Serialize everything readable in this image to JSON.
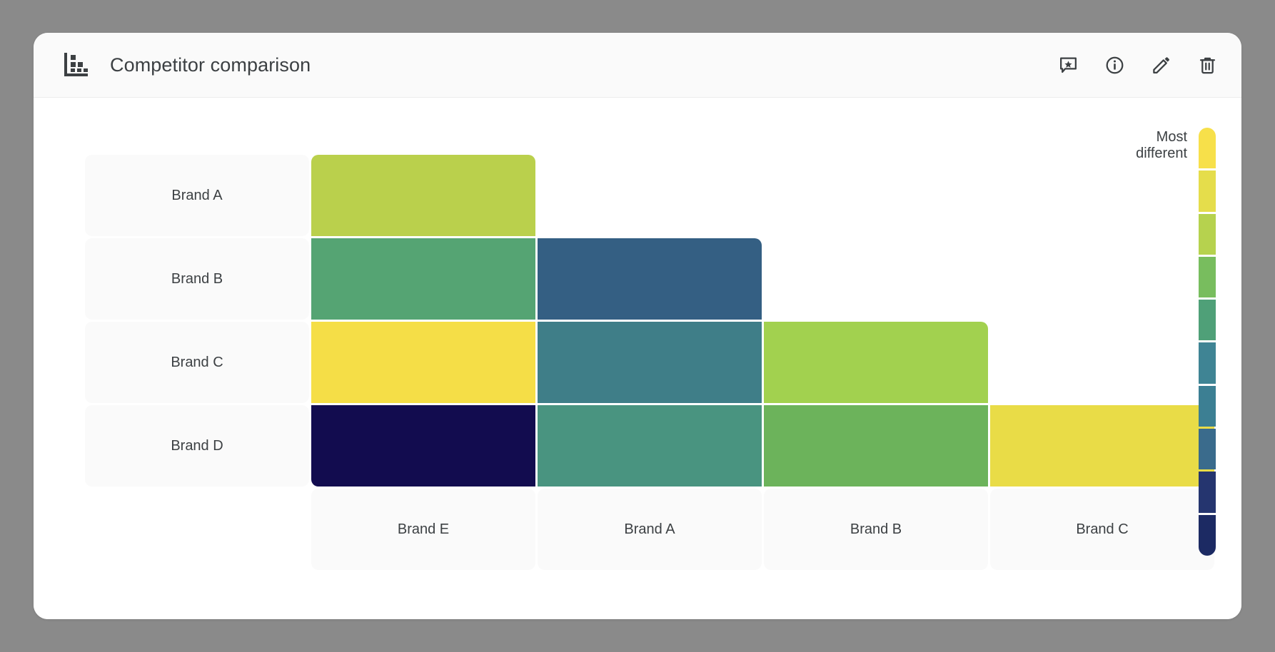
{
  "card": {
    "title": "Competitor comparison",
    "type_icon": "matrix-chart-icon",
    "actions": [
      {
        "name": "insight-comment-icon",
        "label": "Insight"
      },
      {
        "name": "info-icon",
        "label": "Info"
      },
      {
        "name": "edit-pencil-icon",
        "label": "Edit"
      },
      {
        "name": "delete-trash-icon",
        "label": "Delete"
      }
    ]
  },
  "legend": {
    "top_label": "Most\ndifferent",
    "colors": [
      "#f7e04a",
      "#e5dd4b",
      "#b6d24e",
      "#78bd5e",
      "#4fa078",
      "#3f8494",
      "#3c7f93",
      "#3a6b8c",
      "#25356f",
      "#1c2a63"
    ]
  },
  "chart_data": {
    "type": "heatmap",
    "title": "Competitor comparison",
    "xlabel": "",
    "ylabel": "",
    "grid": false,
    "legend_position": "right",
    "row_categories": [
      "Brand A",
      "Brand B",
      "Brand C",
      "Brand D"
    ],
    "column_categories": [
      "Brand E",
      "Brand A",
      "Brand B",
      "Brand C"
    ],
    "shape": "lower-triangular",
    "value_scale_label": "Most different",
    "cells": [
      [
        {
          "row": "Brand A",
          "column": "Brand E",
          "color": "#bad04c",
          "present": true
        },
        {
          "row": "Brand A",
          "column": "Brand A",
          "color": null,
          "present": false
        },
        {
          "row": "Brand A",
          "column": "Brand B",
          "color": null,
          "present": false
        },
        {
          "row": "Brand A",
          "column": "Brand C",
          "color": null,
          "present": false
        }
      ],
      [
        {
          "row": "Brand B",
          "column": "Brand E",
          "color": "#55a473",
          "present": true
        },
        {
          "row": "Brand B",
          "column": "Brand A",
          "color": "#345f83",
          "present": true
        },
        {
          "row": "Brand B",
          "column": "Brand B",
          "color": null,
          "present": false
        },
        {
          "row": "Brand B",
          "column": "Brand C",
          "color": null,
          "present": false
        }
      ],
      [
        {
          "row": "Brand C",
          "column": "Brand E",
          "color": "#f5de47",
          "present": true
        },
        {
          "row": "Brand C",
          "column": "Brand A",
          "color": "#3f7e88",
          "present": true
        },
        {
          "row": "Brand C",
          "column": "Brand B",
          "color": "#a2d14f",
          "present": true
        },
        {
          "row": "Brand C",
          "column": "Brand C",
          "color": null,
          "present": false
        }
      ],
      [
        {
          "row": "Brand D",
          "column": "Brand E",
          "color": "#120c4f",
          "present": true
        },
        {
          "row": "Brand D",
          "column": "Brand A",
          "color": "#499480",
          "present": true
        },
        {
          "row": "Brand D",
          "column": "Brand B",
          "color": "#6cb35b",
          "present": true
        },
        {
          "row": "Brand D",
          "column": "Brand C",
          "color": "#e9dc47",
          "present": true
        }
      ]
    ]
  },
  "theme": {
    "page_background": "#8a8a8a",
    "card_background": "#ffffff",
    "header_background": "#fafafa",
    "label_cell_background": "#fafafa",
    "text_color": "#3c4043"
  }
}
